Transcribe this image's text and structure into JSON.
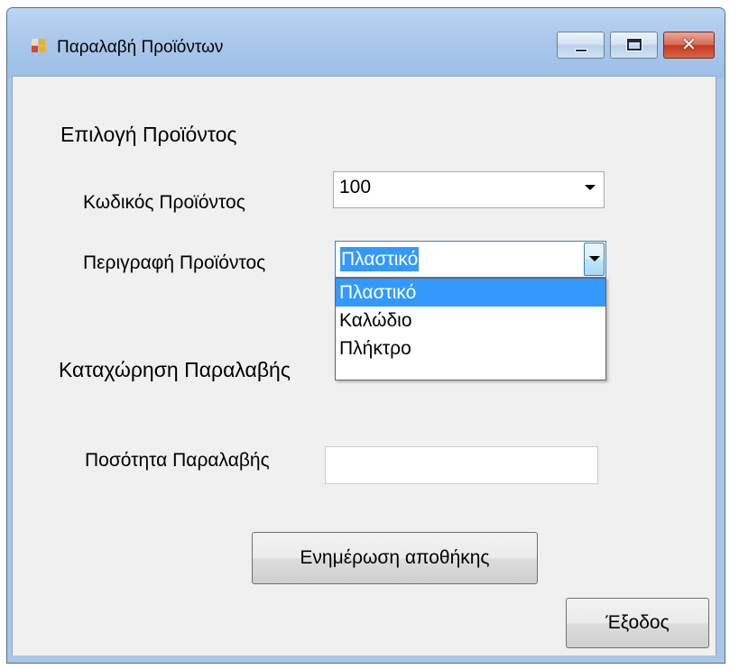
{
  "window": {
    "title": "Παραλαβή Προϊόντων"
  },
  "icons": {
    "app": "app-window-icon",
    "minimize": "minimize-icon",
    "maximize": "maximize-icon",
    "close": "close-icon",
    "dropdown": "chevron-down-icon"
  },
  "colors": {
    "selection": "#3399ff",
    "client_bg": "#f0f0f0",
    "titlebar": "#a9c8eb",
    "close_button": "#c8452a"
  },
  "product_selection": {
    "heading": "Επιλογή Προϊόντος",
    "code_label": "Κωδικός Προϊόντος",
    "code_value": "100",
    "description_label": "Περιγραφή Προϊόντος",
    "description_value": "Πλαστικό",
    "description_options": [
      "Πλαστικό",
      "Καλώδιο",
      "Πλήκτρο"
    ],
    "highlighted_option": "Πλαστικό"
  },
  "receipt": {
    "heading": "Καταχώρηση Παραλαβής",
    "quantity_label": "Ποσότητα Παραλαβής",
    "quantity_value": ""
  },
  "buttons": {
    "update_stock": "Ενημέρωση αποθήκης",
    "exit": "Έξοδος"
  }
}
